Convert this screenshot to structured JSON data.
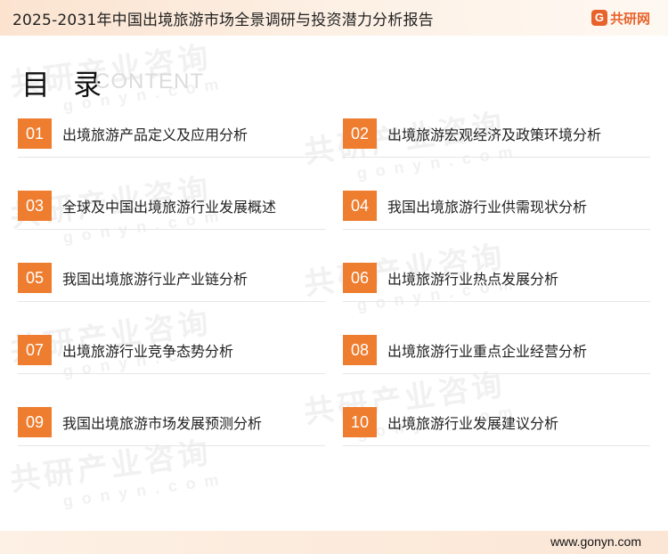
{
  "header": {
    "title": "2025-2031年中国出境旅游市场全景调研与投资潜力分析报告"
  },
  "logo": {
    "mark": "G",
    "text": "共研网"
  },
  "toc": {
    "heading": "目 录",
    "heading_en": "CONTENT",
    "items": [
      {
        "num": "01",
        "label": "出境旅游产品定义及应用分析"
      },
      {
        "num": "02",
        "label": "出境旅游宏观经济及政策环境分析"
      },
      {
        "num": "03",
        "label": "全球及中国出境旅游行业发展概述"
      },
      {
        "num": "04",
        "label": "我国出境旅游行业供需现状分析"
      },
      {
        "num": "05",
        "label": "我国出境旅游行业产业链分析"
      },
      {
        "num": "06",
        "label": "出境旅游行业热点发展分析"
      },
      {
        "num": "07",
        "label": "出境旅游行业竞争态势分析"
      },
      {
        "num": "08",
        "label": "出境旅游行业重点企业经营分析"
      },
      {
        "num": "09",
        "label": "我国出境旅游市场发展预测分析"
      },
      {
        "num": "10",
        "label": "出境旅游行业发展建议分析"
      }
    ]
  },
  "watermark": {
    "cn": "共研产业咨询",
    "en": "gonyn.com"
  },
  "footer": {
    "url": "www.gonyn.com"
  },
  "colors": {
    "accent": "#ee7d2f",
    "brand": "#e8632b"
  }
}
